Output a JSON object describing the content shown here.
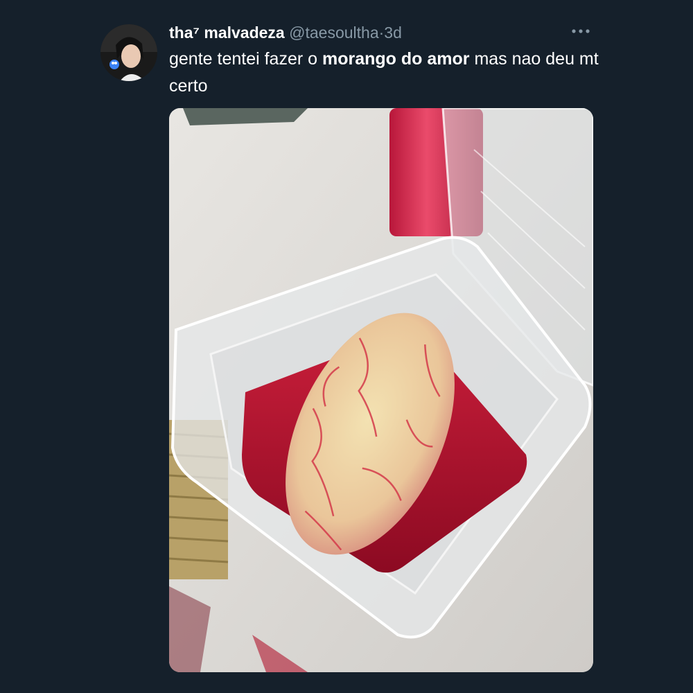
{
  "user": {
    "display_name": "tha⁷ malvadeza",
    "handle": "@taesoultha",
    "separator": "·",
    "time": "3d",
    "avatar_icon": "user-avatar"
  },
  "tweet": {
    "text_part1": "gente tentei fazer o ",
    "text_bold": "morango do amor",
    "text_part2": " mas nao deu mt certo"
  },
  "actions": {
    "more_icon": "more-horizontal-icon"
  },
  "colors": {
    "background": "#15202b",
    "primary_text": "#ffffff",
    "secondary_text": "#8899a6"
  }
}
